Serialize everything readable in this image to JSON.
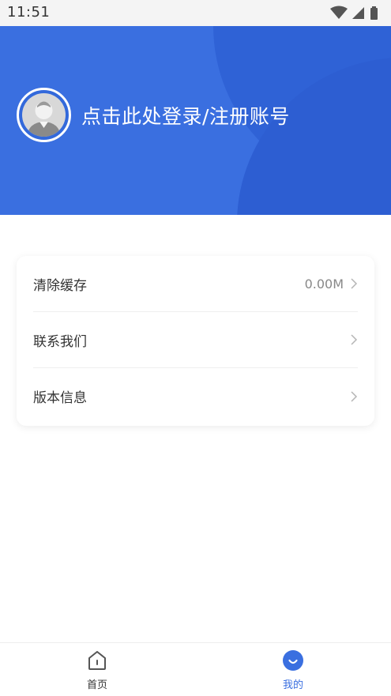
{
  "status_bar": {
    "time": "11:51"
  },
  "header": {
    "login_prompt": "点击此处登录/注册账号"
  },
  "menu": {
    "items": [
      {
        "label": "清除缓存",
        "value": "0.00M"
      },
      {
        "label": "联系我们",
        "value": ""
      },
      {
        "label": "版本信息",
        "value": ""
      }
    ]
  },
  "tabbar": {
    "tabs": [
      {
        "label": "首页",
        "active": false,
        "icon": "home-icon"
      },
      {
        "label": "我的",
        "active": true,
        "icon": "profile-icon"
      }
    ]
  },
  "colors": {
    "primary": "#3369db",
    "tab_active": "#3a6fe0",
    "tab_inactive": "#333333"
  }
}
